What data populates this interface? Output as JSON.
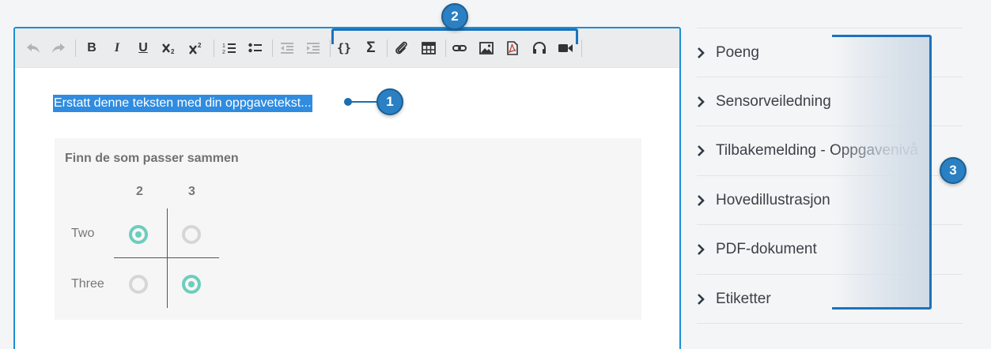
{
  "editor": {
    "placeholder_text": "Erstatt denne teksten med din oppgavetekst...",
    "toolbar": {
      "undo_icon": "undo-icon",
      "redo_icon": "redo-icon",
      "bold_label": "B",
      "italic_label": "I",
      "underline_label": "U"
    }
  },
  "match_question": {
    "title": "Finn de som passer sammen",
    "columns": [
      "2",
      "3"
    ],
    "rows": [
      {
        "label": "Two",
        "selected": [
          true,
          false
        ]
      },
      {
        "label": "Three",
        "selected": [
          false,
          true
        ]
      }
    ]
  },
  "side_panel": {
    "items": [
      {
        "label": "Poeng"
      },
      {
        "label": "Sensorveiledning"
      },
      {
        "label": "Tilbakemelding - Oppgavenivå"
      },
      {
        "label": "Hovedillustrasjon"
      },
      {
        "label": "PDF-dokument"
      },
      {
        "label": "Etiketter"
      }
    ]
  },
  "annotations": {
    "badge_1": "1",
    "badge_2": "2",
    "badge_3": "3",
    "accent_color": "#2b80c3"
  }
}
